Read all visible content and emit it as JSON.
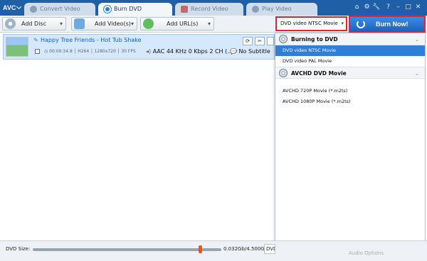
{
  "app": {
    "logo": "AVC"
  },
  "tabs": [
    {
      "label": "Convert Video"
    },
    {
      "label": "Burn DVD"
    },
    {
      "label": "Record Video"
    },
    {
      "label": "Play Video"
    }
  ],
  "window_controls": [
    "⌂",
    "⚙",
    "🔧",
    "?",
    "–",
    "□",
    "✕"
  ],
  "toolbar": {
    "add_disc": "Add Disc",
    "add_videos": "Add Video(s)",
    "add_urls": "Add URL(s)",
    "dropdown_arrow": "▾"
  },
  "file": {
    "name": "Happy Tree Friends - Hot Tub Shake",
    "duration": "00:00:34.8",
    "codec": "H264",
    "resolution": "1280x720",
    "fps": "30 FPS",
    "audio": "AAC 44 KHz 0 Kbps 2 CH (...",
    "subtitle": "No Subtitle",
    "edit_icon": "✎",
    "scissors_icon": "✂"
  },
  "format_selector": {
    "value": "DVD video NTSC Movie",
    "arrow": "▾"
  },
  "burn_button": {
    "label": "Burn Now!"
  },
  "dropdown": {
    "groups": [
      {
        "title": "Burning to DVD",
        "options": [
          {
            "label": "DVD video NTSC Movie",
            "selected": true
          },
          {
            "label": "DVD video PAL Movie",
            "selected": false
          }
        ]
      },
      {
        "title": "AVCHD DVD Movie",
        "options": [
          {
            "label": "AVCHD 720P Movie (*.m2ts)",
            "selected": false
          },
          {
            "label": "AVCHD 1080P Movie (*.m2ts)",
            "selected": false
          }
        ]
      }
    ],
    "chevron": "⌄"
  },
  "status": {
    "dvd_size_label": "DVD Size:",
    "capacity": "0.032Gb/4.500Gb",
    "dvd_type": "DVD",
    "audio_options": "Audio Options"
  },
  "colors": {
    "titlebar": "#1f5fa8",
    "burn_button": "#1a6fd0",
    "highlight_border": "#d9283b",
    "selected_option": "#2f7fd8"
  }
}
